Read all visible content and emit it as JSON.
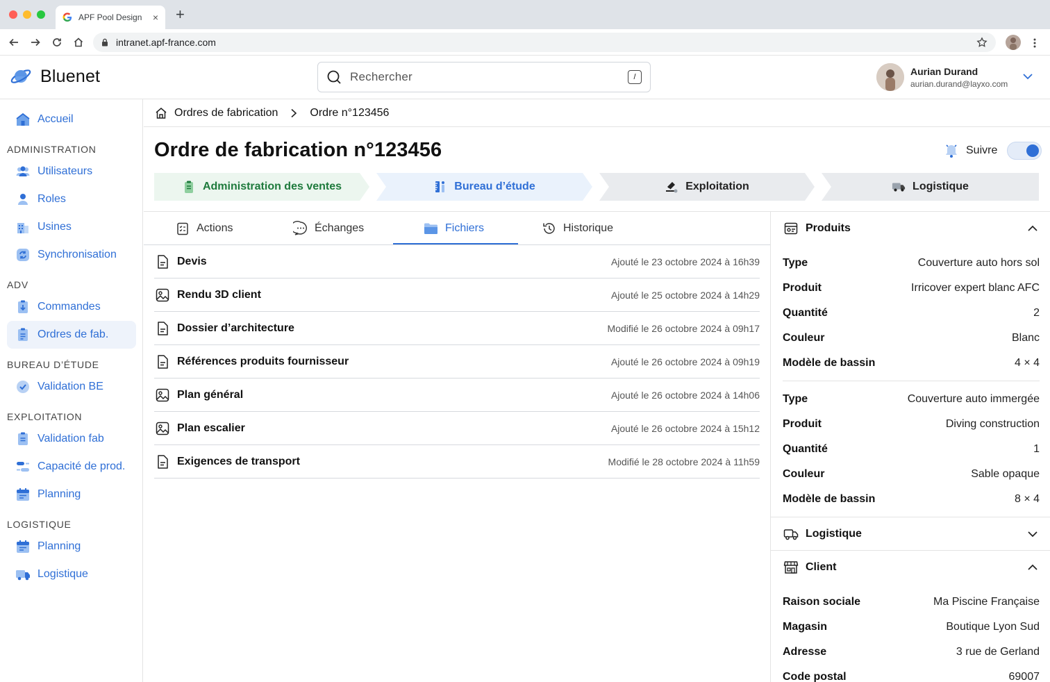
{
  "browser": {
    "tab_title": "APF Pool Design",
    "tab_close": "×",
    "new_tab": "+",
    "url": "intranet.apf-france.com"
  },
  "header": {
    "brand": "Bluenet",
    "search_placeholder": "Rechercher",
    "search_shortcut": "/",
    "user_name": "Aurian Durand",
    "user_email": "aurian.durand@layxo.com"
  },
  "sidebar": {
    "home": "Accueil",
    "sections": [
      {
        "title": "ADMINISTRATION",
        "items": [
          "Utilisateurs",
          "Roles",
          "Usines",
          "Synchronisation"
        ]
      },
      {
        "title": "ADV",
        "items": [
          "Commandes",
          "Ordres de fab."
        ]
      },
      {
        "title": "BUREAU D’ÉTUDE",
        "items": [
          "Validation BE"
        ]
      },
      {
        "title": "EXPLOITATION",
        "items": [
          "Validation fab",
          "Capacité de prod.",
          "Planning"
        ]
      },
      {
        "title": "LOGISTIQUE",
        "items": [
          "Planning",
          "Logistique"
        ]
      }
    ],
    "active_item": "Ordres de fab."
  },
  "breadcrumb": {
    "parent": "Ordres de fabrication",
    "current": "Ordre n°123456"
  },
  "page": {
    "title": "Ordre de fabrication n°123456",
    "follow_label": "Suivre",
    "follow_on": true
  },
  "steps": [
    {
      "label": "Administration des ventes",
      "icon": "clipboard-icon",
      "state": "done"
    },
    {
      "label": "Bureau d’étude",
      "icon": "ruler-icon",
      "state": "current"
    },
    {
      "label": "Exploitation",
      "icon": "factory-icon",
      "state": "todo"
    },
    {
      "label": "Logistique",
      "icon": "truck-icon",
      "state": "todo"
    }
  ],
  "tabs": [
    {
      "label": "Actions",
      "icon": "checklist-icon"
    },
    {
      "label": "Échanges",
      "icon": "chat-icon"
    },
    {
      "label": "Fichiers",
      "icon": "folder-icon"
    },
    {
      "label": "Historique",
      "icon": "history-icon"
    }
  ],
  "active_tab": "Fichiers",
  "files": [
    {
      "name": "Devis",
      "date": "Ajouté le 23 octobre 2024 à 16h39",
      "icon": "document-icon"
    },
    {
      "name": "Rendu 3D client",
      "date": "Ajouté le 25 octobre 2024 à 14h29",
      "icon": "image-icon"
    },
    {
      "name": "Dossier d’architecture",
      "date": "Modifié le 26 octobre 2024 à 09h17",
      "icon": "document-icon"
    },
    {
      "name": "Références produits fournisseur",
      "date": "Ajouté le 26 octobre 2024 à 09h19",
      "icon": "document-icon"
    },
    {
      "name": "Plan général",
      "date": "Ajouté le 26 octobre 2024 à 14h06",
      "icon": "image-icon"
    },
    {
      "name": "Plan escalier",
      "date": "Ajouté le 26 octobre 2024 à 15h12",
      "icon": "image-icon"
    },
    {
      "name": "Exigences de transport",
      "date": "Modifié le 28 octobre 2024 à 11h59",
      "icon": "document-icon"
    }
  ],
  "panel": {
    "products_title": "Produits",
    "products": [
      [
        {
          "k": "Type",
          "v": "Couverture auto hors sol"
        },
        {
          "k": "Produit",
          "v": "Irricover expert blanc AFC"
        },
        {
          "k": "Quantité",
          "v": "2"
        },
        {
          "k": "Couleur",
          "v": "Blanc"
        },
        {
          "k": "Modèle de bassin",
          "v": "4 × 4"
        }
      ],
      [
        {
          "k": "Type",
          "v": "Couverture auto immergée"
        },
        {
          "k": "Produit",
          "v": "Diving construction"
        },
        {
          "k": "Quantité",
          "v": "1"
        },
        {
          "k": "Couleur",
          "v": "Sable opaque"
        },
        {
          "k": "Modèle de bassin",
          "v": "8 × 4"
        }
      ]
    ],
    "logistics_title": "Logistique",
    "client_title": "Client",
    "client": [
      {
        "k": "Raison sociale",
        "v": "Ma Piscine Française"
      },
      {
        "k": "Magasin",
        "v": "Boutique Lyon Sud"
      },
      {
        "k": "Adresse",
        "v": "3 rue de Gerland"
      },
      {
        "k": "Code postal",
        "v": "69007"
      }
    ]
  },
  "colors": {
    "accent": "#2f6fd6",
    "done_bg": "#ecf6ef",
    "done_text": "#1e7a3c",
    "current_bg": "#eaf2fc",
    "todo_bg": "#e9ebee"
  }
}
